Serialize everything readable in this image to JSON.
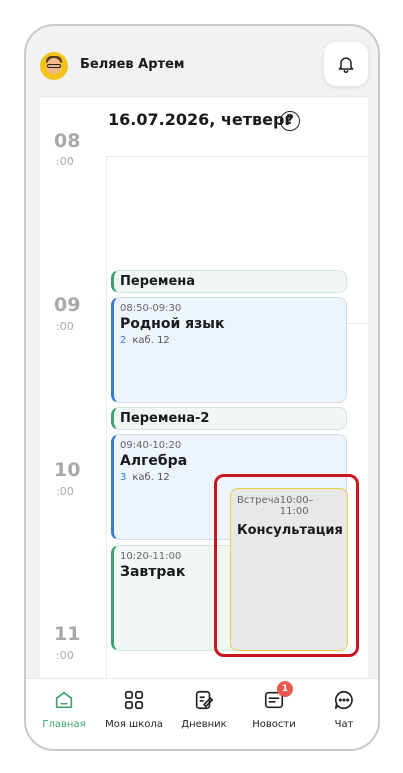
{
  "user": {
    "name": "Беляев Артем"
  },
  "schedule": {
    "date_title": "16.07.2026, четверг",
    "help_glyph": "?",
    "hours": [
      {
        "hour": "08",
        "min": ":00"
      },
      {
        "hour": "09",
        "min": ":00"
      },
      {
        "hour": "10",
        "min": ":00"
      },
      {
        "hour": "11",
        "min": ":00"
      }
    ],
    "breaks": [
      "Перемена",
      "Перемена-2"
    ],
    "lessons": [
      {
        "time": "08:50-09:30",
        "title": "Родной язык",
        "num": "2",
        "room": "каб. 12"
      },
      {
        "time": "09:40-10:20",
        "title": "Алгебра",
        "num": "3",
        "room": "каб. 12"
      },
      {
        "time": "10:20-11:00",
        "title": "Завтрак"
      }
    ],
    "meeting": {
      "type": "Встреча",
      "time": "10:00–11:00",
      "title": "Консультация"
    }
  },
  "nav": {
    "items": [
      {
        "label": "Главная",
        "icon": "home-icon",
        "active": true
      },
      {
        "label": "Моя школа",
        "icon": "grid-icon"
      },
      {
        "label": "Дневник",
        "icon": "diary-icon"
      },
      {
        "label": "Новости",
        "icon": "news-icon",
        "badge": "1"
      },
      {
        "label": "Чат",
        "icon": "chat-icon"
      }
    ]
  },
  "colors": {
    "accent": "#3da36e",
    "lesson_blue": "#3a7bd5",
    "highlight": "#c9151e",
    "meeting_border": "#e7cf4a"
  }
}
